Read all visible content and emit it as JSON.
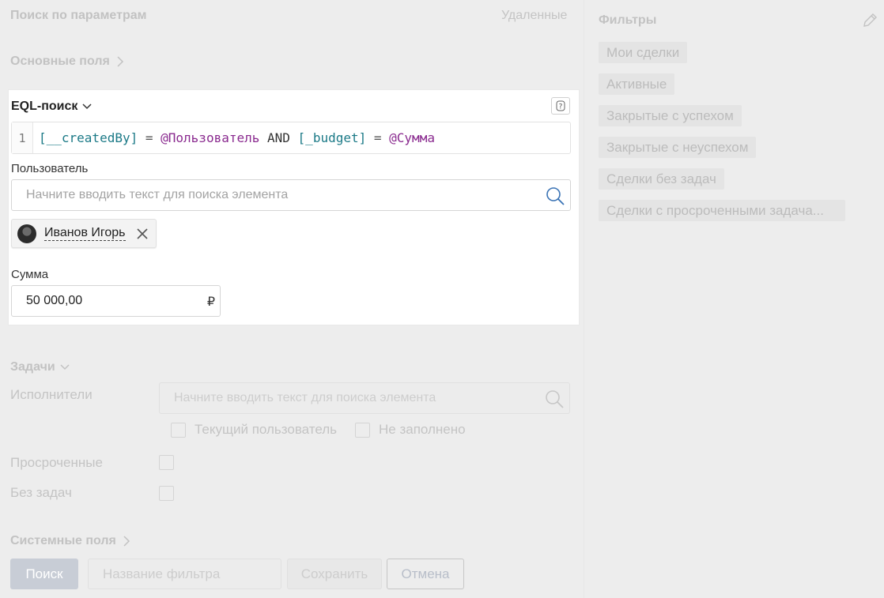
{
  "header": {
    "title": "Поиск по параметрам",
    "deleted_link": "Удаленные"
  },
  "sections": {
    "main_fields": "Основные поля",
    "system_fields": "Системные поля"
  },
  "eql": {
    "title": "EQL-поиск",
    "help": "?",
    "line_number": "1",
    "code": {
      "field1": "[__createdBy]",
      "eq1": " = ",
      "var1": "@Пользователь",
      "kw": " AND ",
      "field2": "[_budget]",
      "eq2": " = ",
      "var2": "@Сумма"
    },
    "user_label": "Пользователь",
    "user_placeholder": "Начните вводить текст для поиска элемента",
    "selected_user": "Иванов Игорь",
    "sum_label": "Сумма",
    "sum_value": "50 000,00",
    "currency": "₽"
  },
  "tasks": {
    "title": "Задачи",
    "executors_label": "Исполнители",
    "executors_placeholder": "Начните вводить текст для поиска элемента",
    "current_user": "Текущий пользователь",
    "not_filled": "Не заполнено",
    "overdue": "Просроченные",
    "no_tasks": "Без задач"
  },
  "footer": {
    "search_button": "Поиск",
    "filter_name_placeholder": "Название фильтра",
    "save_button": "Сохранить",
    "cancel_button": "Отмена"
  },
  "filters": {
    "title": "Фильтры",
    "items": [
      "Мои сделки",
      "Активные",
      "Закрытые с успехом",
      "Закрытые с неуспехом",
      "Сделки без задач",
      "Сделки с просроченными задача..."
    ]
  },
  "colors": {
    "accent": "#1c7a87",
    "variable": "#8a2a8f",
    "primary_button": "#c8cdd6"
  }
}
